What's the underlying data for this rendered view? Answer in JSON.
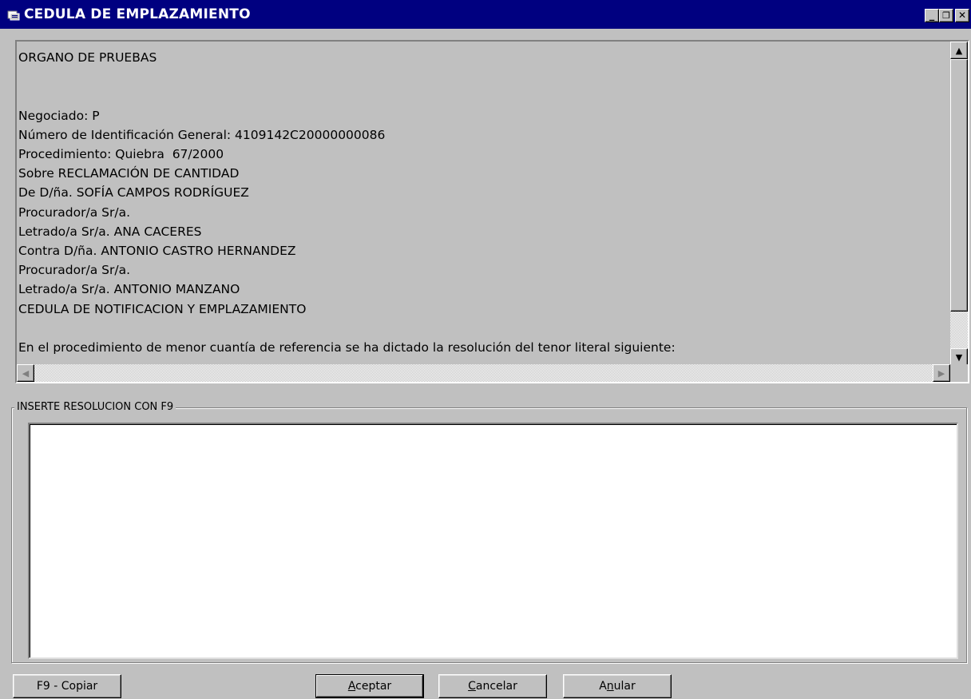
{
  "window": {
    "title": "CEDULA DE EMPLAZAMIENTO",
    "title_icon": "app-icon",
    "minimize_glyph": "_",
    "maximize_glyph": "❐",
    "close_glyph": "✕",
    "titlebar_color": "#000080",
    "background_color": "#c0c0c0"
  },
  "document": {
    "lines": [
      "ORGANO DE PRUEBAS",
      "",
      "",
      "Negociado: P",
      "Número de Identificación General: 4109142C20000000086",
      "Procedimiento: Quiebra  67/2000",
      "Sobre RECLAMACIÓN DE CANTIDAD",
      "De D/ña. SOFÍA CAMPOS RODRÍGUEZ",
      "Procurador/a Sr/a.",
      "Letrado/a Sr/a. ANA CACERES",
      "Contra D/ña. ANTONIO CASTRO HERNANDEZ",
      "Procurador/a Sr/a.",
      "Letrado/a Sr/a. ANTONIO MANZANO",
      "CEDULA DE NOTIFICACION Y EMPLAZAMIENTO",
      "",
      "En el procedimiento de menor cuantía de referencia se ha dictado la resolución del tenor literal siguiente:"
    ],
    "scroll_up_glyph": "▲",
    "scroll_down_glyph": "▼",
    "scroll_left_glyph": "◀",
    "scroll_right_glyph": "▶"
  },
  "resolution_group": {
    "legend": "INSERTE RESOLUCION CON F9",
    "value": ""
  },
  "buttons": {
    "copy": {
      "label": "F9 - Copiar"
    },
    "accept": {
      "prefix": "",
      "mnemonic": "A",
      "rest": "ceptar"
    },
    "cancel": {
      "prefix": "",
      "mnemonic": "C",
      "rest": "ancelar"
    },
    "void": {
      "prefix": "A",
      "mnemonic": "n",
      "rest": "ular"
    }
  }
}
